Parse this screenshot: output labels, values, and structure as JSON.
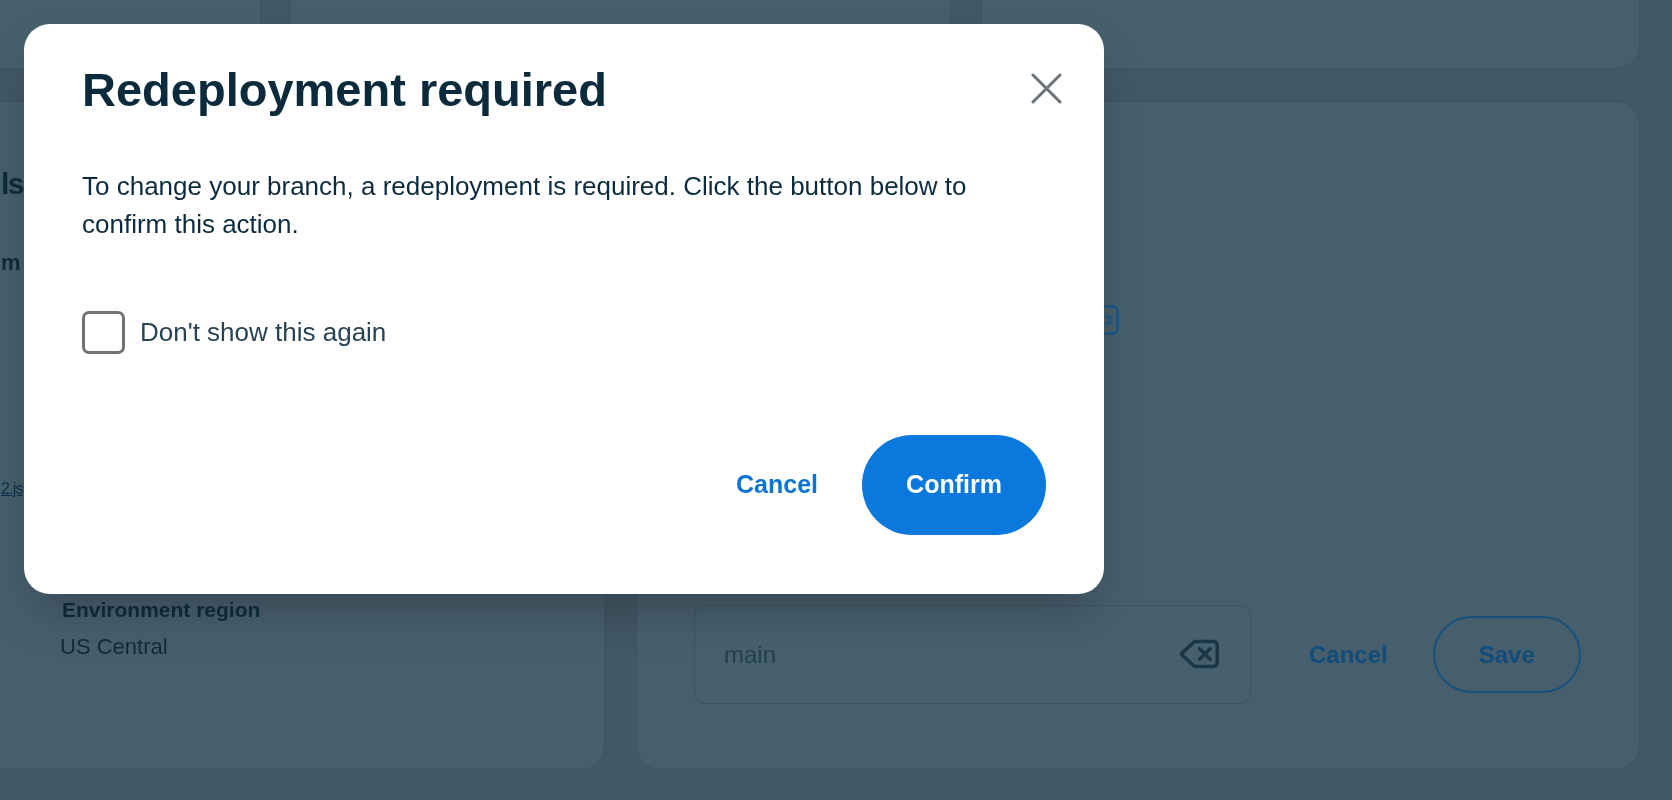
{
  "page": {
    "left_card": {
      "heading": "ls",
      "label": "m",
      "link": "2.js",
      "region_label": "Environment region",
      "region_value": "US Central"
    },
    "right_card": {
      "branch_field": {
        "value": "main"
      },
      "cancel_button": "Cancel",
      "save_button": "Save"
    }
  },
  "dialog": {
    "title": "Redeployment required",
    "message": "To change your branch, a redeployment is required. Click the button below to confirm this action.",
    "checkbox": {
      "label": "Don't show this again",
      "checked": false
    },
    "actions": [
      {
        "label": "Cancel",
        "kind": "text"
      },
      {
        "label": "Confirm",
        "kind": "primary"
      }
    ]
  }
}
